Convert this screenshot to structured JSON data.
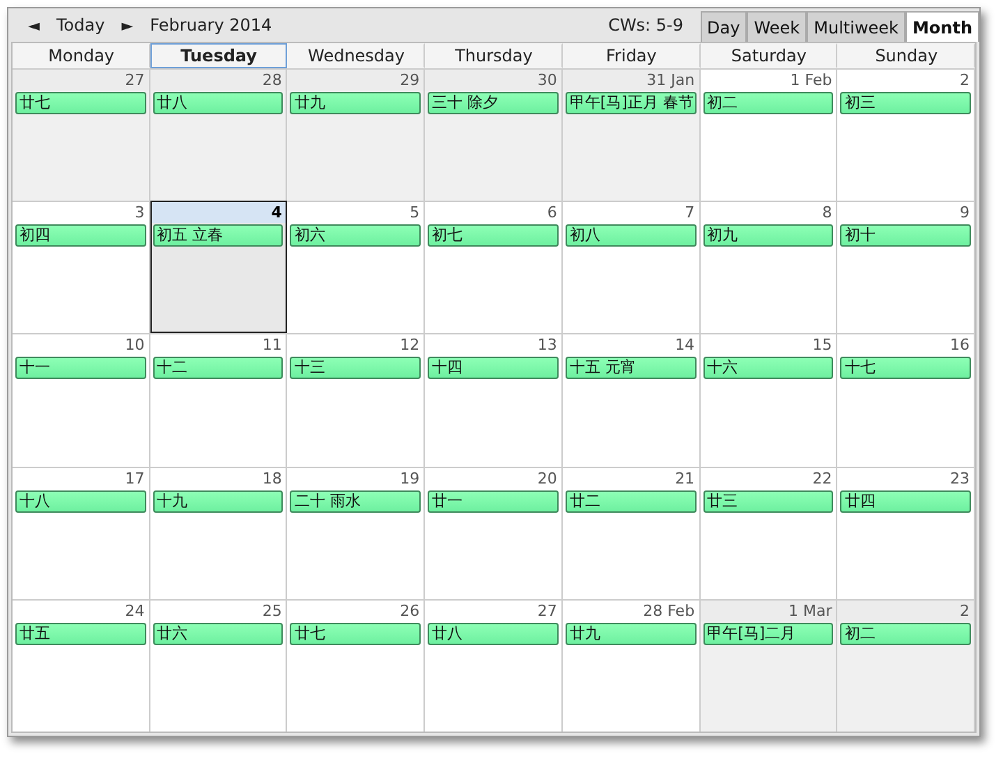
{
  "toolbar": {
    "prev": "◄",
    "today": "Today",
    "next": "►",
    "month": "February 2014",
    "weeks_label": "CWs: 5-9"
  },
  "tabs": [
    {
      "label": "Day",
      "selected": false
    },
    {
      "label": "Week",
      "selected": false
    },
    {
      "label": "Multiweek",
      "selected": false
    },
    {
      "label": "Month",
      "selected": true
    }
  ],
  "weekdays": [
    {
      "label": "Monday",
      "today": false
    },
    {
      "label": "Tuesday",
      "today": true
    },
    {
      "label": "Wednesday",
      "today": false
    },
    {
      "label": "Thursday",
      "today": false
    },
    {
      "label": "Friday",
      "today": false
    },
    {
      "label": "Saturday",
      "today": false
    },
    {
      "label": "Sunday",
      "today": false
    }
  ],
  "weeks": [
    [
      {
        "date": "27",
        "event": "廿七",
        "in_month": false,
        "today": false
      },
      {
        "date": "28",
        "event": "廿八",
        "in_month": false,
        "today": false
      },
      {
        "date": "29",
        "event": "廿九",
        "in_month": false,
        "today": false
      },
      {
        "date": "30",
        "event": "三十 除夕",
        "in_month": false,
        "today": false
      },
      {
        "date": "31 Jan",
        "event": "甲午[马]正月 春节",
        "in_month": false,
        "today": false
      },
      {
        "date": "1 Feb",
        "event": "初二",
        "in_month": true,
        "today": false
      },
      {
        "date": "2",
        "event": "初三",
        "in_month": true,
        "today": false
      }
    ],
    [
      {
        "date": "3",
        "event": "初四",
        "in_month": true,
        "today": false
      },
      {
        "date": "4",
        "event": "初五 立春",
        "in_month": true,
        "today": true
      },
      {
        "date": "5",
        "event": "初六",
        "in_month": true,
        "today": false
      },
      {
        "date": "6",
        "event": "初七",
        "in_month": true,
        "today": false
      },
      {
        "date": "7",
        "event": "初八",
        "in_month": true,
        "today": false
      },
      {
        "date": "8",
        "event": "初九",
        "in_month": true,
        "today": false
      },
      {
        "date": "9",
        "event": "初十",
        "in_month": true,
        "today": false
      }
    ],
    [
      {
        "date": "10",
        "event": "十一",
        "in_month": true,
        "today": false
      },
      {
        "date": "11",
        "event": "十二",
        "in_month": true,
        "today": false
      },
      {
        "date": "12",
        "event": "十三",
        "in_month": true,
        "today": false
      },
      {
        "date": "13",
        "event": "十四",
        "in_month": true,
        "today": false
      },
      {
        "date": "14",
        "event": "十五 元宵",
        "in_month": true,
        "today": false
      },
      {
        "date": "15",
        "event": "十六",
        "in_month": true,
        "today": false
      },
      {
        "date": "16",
        "event": "十七",
        "in_month": true,
        "today": false
      }
    ],
    [
      {
        "date": "17",
        "event": "十八",
        "in_month": true,
        "today": false
      },
      {
        "date": "18",
        "event": "十九",
        "in_month": true,
        "today": false
      },
      {
        "date": "19",
        "event": "二十 雨水",
        "in_month": true,
        "today": false
      },
      {
        "date": "20",
        "event": "廿一",
        "in_month": true,
        "today": false
      },
      {
        "date": "21",
        "event": "廿二",
        "in_month": true,
        "today": false
      },
      {
        "date": "22",
        "event": "廿三",
        "in_month": true,
        "today": false
      },
      {
        "date": "23",
        "event": "廿四",
        "in_month": true,
        "today": false
      }
    ],
    [
      {
        "date": "24",
        "event": "廿五",
        "in_month": true,
        "today": false
      },
      {
        "date": "25",
        "event": "廿六",
        "in_month": true,
        "today": false
      },
      {
        "date": "26",
        "event": "廿七",
        "in_month": true,
        "today": false
      },
      {
        "date": "27",
        "event": "廿八",
        "in_month": true,
        "today": false
      },
      {
        "date": "28 Feb",
        "event": "廿九",
        "in_month": true,
        "today": false
      },
      {
        "date": "1 Mar",
        "event": "甲午[马]二月",
        "in_month": false,
        "today": false
      },
      {
        "date": "2",
        "event": "初二",
        "in_month": false,
        "today": false
      }
    ]
  ]
}
